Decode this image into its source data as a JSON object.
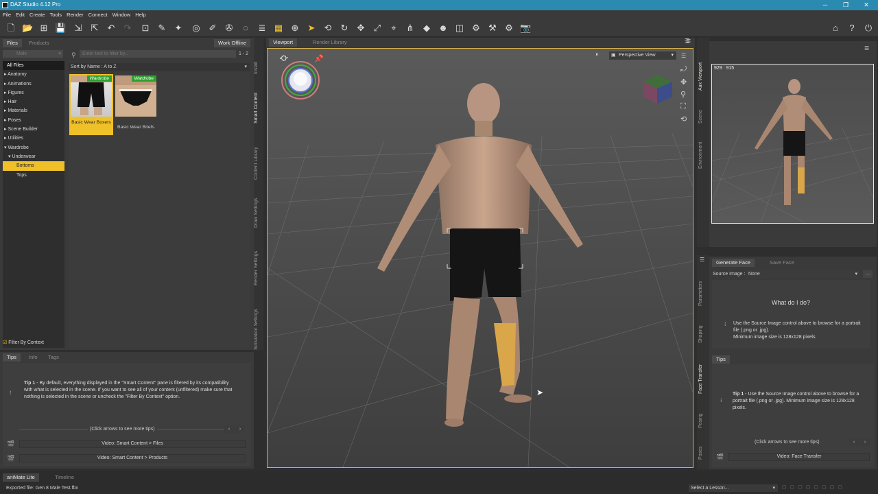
{
  "window": {
    "title": "DAZ Studio 4.12 Pro",
    "minimize": "─",
    "maximize": "❐",
    "close": "✕"
  },
  "menu": [
    "File",
    "Edit",
    "Create",
    "Tools",
    "Render",
    "Connect",
    "Window",
    "Help"
  ],
  "left_panel": {
    "tabs": [
      "Files",
      "Products"
    ],
    "work_offline": "Work Offline",
    "side_tabs": [
      "Install",
      "Smart Content",
      "Content Library",
      "Draw Settings",
      "Render Settings",
      "Simulation Settings"
    ],
    "category_select": "Male",
    "search_placeholder": "Enter text to filter by...",
    "page_count": "1 - 2",
    "sort": "Sort by Name : A to Z",
    "tree": [
      "All Files",
      "▸ Anatomy",
      "▸ Animations",
      "▸ Figures",
      "▸ Hair",
      "▸ Materials",
      "▸ Poses",
      "▸ Scene Builder",
      "▸ Utilities",
      "▾ Wardrobe",
      "▾ Underwear",
      "Bottoms",
      "Tops"
    ],
    "products": [
      {
        "badge": "Wardrobe",
        "label": "Basic Wear Boxers"
      },
      {
        "badge": "Wardrobe",
        "label": "Basic Wear Briefs"
      }
    ],
    "filter_by_context": "Filter By Context"
  },
  "tips_panel": {
    "tabs": [
      "Tips",
      "Info",
      "Tags"
    ],
    "tip_title": "Tip 1",
    "tip_text": " - By default, everything displayed in the \"Smart Content\" pane is filtered by its compatibility with what is selected in the scene. If you want to see all of your content (unfiltered) make sure that nothing is selected in the scene or uncheck the \"Filter By Context\" option.",
    "more_tips": "(Click arrows to see more tips)",
    "video1": "Video: Smart Content > Files",
    "video2": "Video: Smart Content > Products"
  },
  "viewport": {
    "tabs": [
      "Viewport",
      "Render Library"
    ],
    "camera": "Perspective View"
  },
  "aux": {
    "side_tabs": [
      "Aux Viewport",
      "Scene",
      "Environment"
    ],
    "resolution": "929 : 915"
  },
  "right_panel": {
    "tabs": [
      "Generate Face",
      "Save Face"
    ],
    "side_tabs": [
      "Parameters",
      "Shaping",
      "Face Transfer",
      "Posing",
      "Poses"
    ],
    "source_label": "Source Image :",
    "source_value": "None",
    "what_heading": "What do I do?",
    "what_text": "Use the Source Image control above to browse for a portrait file (.png or .jpg).\nMinimum image size is 128x128 pixels.",
    "tips_tab": "Tips",
    "tip_title": "Tip 1",
    "tip_text": " - Use the Source Image control above to browse for a portrait file (.png or .jpg). Minimum image size is 128x128 pixels.",
    "more_tips": "(Click arrows to see more tips)",
    "video": "Video: Face Transfer"
  },
  "bottom": {
    "tabs": [
      "aniMate Lite",
      "Timeline"
    ],
    "status": "Exported file: Gen 8 Male Test.fbx",
    "lesson": "Select a Lesson..."
  },
  "colors": {
    "accent": "#f0c028",
    "titlebar": "#2a8ab0",
    "badge": "#2ea02e"
  }
}
